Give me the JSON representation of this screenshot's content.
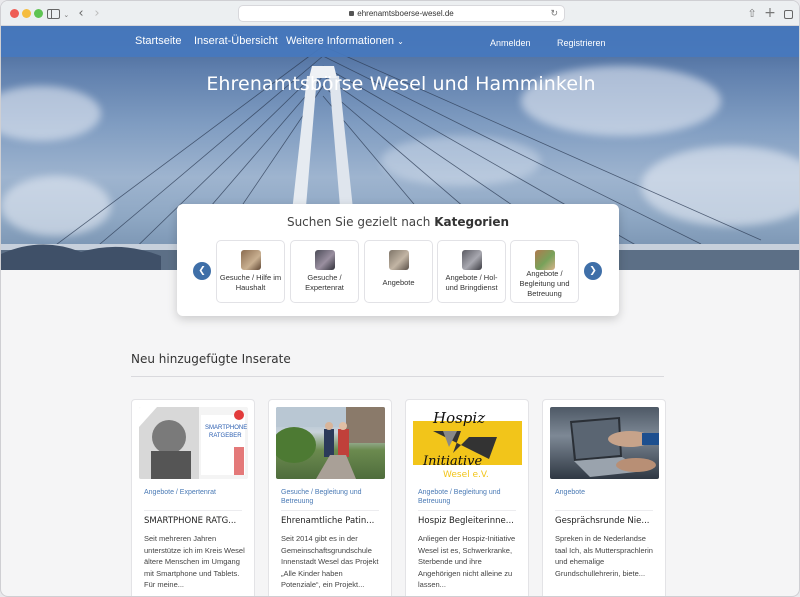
{
  "browser": {
    "url": "ehrenamtsboerse-wesel.de"
  },
  "nav": {
    "items": [
      "Startseite",
      "Inserat-Übersicht",
      "Weitere Informationen"
    ],
    "dropdown_chevron": "chevron-down-icon",
    "login": "Anmelden",
    "register": "Registrieren"
  },
  "hero": {
    "title": "Ehrenamtsbörse Wesel und Hamminkeln"
  },
  "categories": {
    "heading_prefix": "Suchen Sie gezielt nach",
    "heading_bold": "Kategorien",
    "items": [
      {
        "label": "Gesuche / Hilfe im Haushalt"
      },
      {
        "label": "Gesuche / Expertenrat"
      },
      {
        "label": "Angebote"
      },
      {
        "label": "Angebote / Hol- und Bringdienst"
      },
      {
        "label": "Angebote / Begleitung und Betreuung"
      }
    ]
  },
  "listings": {
    "title": "Neu hinzugefügte Inserate",
    "cards": [
      {
        "category": "Angebote / Expertenrat",
        "title": "SMARTPHONE RATG...",
        "text": "Seit mehreren Jahren unterstütze ich im Kreis Wesel ältere Menschen im Umgang mit Smartphone und Tablets. Für meine..."
      },
      {
        "category": "Gesuche / Begleitung und Betreuung",
        "title": "Ehrenamtliche Patin...",
        "text": "Seit 2014 gibt es in der Gemeinschaftsgrundschule Innenstadt Wesel das Projekt „Alle Kinder haben Potenziale“, ein Projekt..."
      },
      {
        "category": "Angebote / Begleitung und Betreuung",
        "title": "Hospiz Begleiterinne...",
        "text": "Anliegen der Hospiz-Initiative Wesel ist es, Schwerkranke, Sterbende und ihre Angehörigen nicht alleine zu lassen..."
      },
      {
        "category": "Angebote",
        "title": "Gesprächsrunde Nie...",
        "text": "Spreken in de Nederlandse taal Ich, als Muttersprachlerin und ehemalige Grundschullehrerin, biete..."
      }
    ],
    "image_texts": {
      "smartphone_1": "SMARTPHONE",
      "smartphone_2": "RATGEBER",
      "hospiz_1": "Hospiz",
      "hospiz_2": "Initiative",
      "hospiz_3": "Wesel e.V."
    }
  },
  "colors": {
    "nav_bg": "#4678be",
    "accent": "#3f6fa8",
    "link": "#4a7ab5"
  }
}
